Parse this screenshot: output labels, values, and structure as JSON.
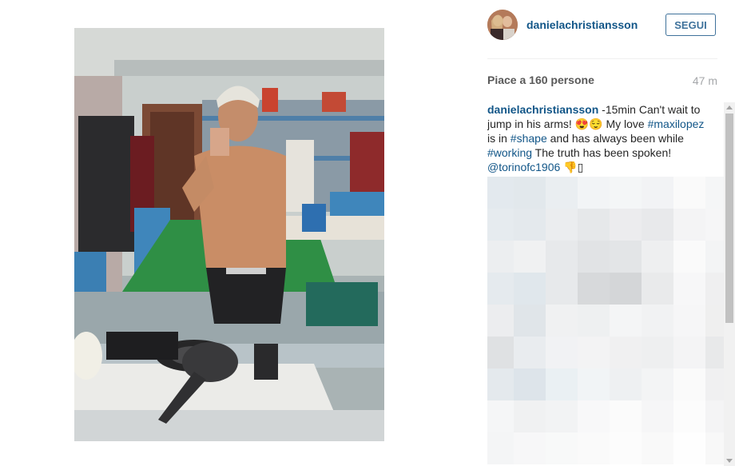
{
  "post": {
    "photo_alt": "Mirror selfie in a locker room"
  },
  "header": {
    "username": "danielachristiansson",
    "follow_label": "SEGUI"
  },
  "stats": {
    "likes": "Piace a 160 persone",
    "time_ago": "47 m"
  },
  "caption": {
    "author": "danielachristiansson",
    "text_1": " -15min Can't wait to jump in his arms! 😍😌 My love ",
    "mention_1": "#maxilopez",
    "text_2": " is in ",
    "hashtag_1": "#shape",
    "text_3": " and has always been while ",
    "hashtag_2": "#working",
    "text_4": " The truth has been spoken! ",
    "mention_2": "@torinofc1906",
    "text_5": " 👎▯"
  },
  "blurred_comments": {
    "colors": [
      "#e3e9ee",
      "#e2e8ec",
      "#eaeef1",
      "#f2f4f6",
      "#f4f6f7",
      "#f2f3f5",
      "#fafafa",
      "#f5f6f7",
      "#e6ebef",
      "#e4e9ed",
      "#ebedef",
      "#e6e8ea",
      "#ececee",
      "#e8e9eb",
      "#f4f4f5",
      "#f6f6f7",
      "#eceef0",
      "#f0f1f2",
      "#e7e9eb",
      "#e1e3e5",
      "#e3e5e7",
      "#eeeff0",
      "#fafafa",
      "#f3f4f5",
      "#e5eaee",
      "#e0e7ec",
      "#e7e9eb",
      "#d7d9db",
      "#d4d6d8",
      "#e9eaeb",
      "#f7f7f8",
      "#efeff0",
      "#ecedef",
      "#e0e5e9",
      "#f0f1f2",
      "#eef0f1",
      "#f4f5f6",
      "#f1f2f3",
      "#f6f6f7",
      "#efefef",
      "#dfe1e3",
      "#e9ecef",
      "#f1f2f4",
      "#f3f3f4",
      "#f0f0f1",
      "#eeeff0",
      "#f4f4f5",
      "#e8e9ea",
      "#e4e9ed",
      "#dde4ea",
      "#eaf0f3",
      "#f1f4f6",
      "#eef0f2",
      "#f3f4f5",
      "#fafafa",
      "#f0f0f1",
      "#f5f6f7",
      "#f0f1f2",
      "#f2f3f4",
      "#f8f8f9",
      "#fbfbfb",
      "#f6f6f7",
      "#fcfcfc",
      "#f4f4f5",
      "#f4f5f6",
      "#f7f7f8",
      "#f8f9f9",
      "#fafafa",
      "#fcfcfc",
      "#f9f9f9",
      "#fefefe",
      "#f8f8f8"
    ]
  },
  "colors": {
    "link_blue": "#125688",
    "follow_blue": "#3f729b",
    "muted_gray": "#a5a7aa"
  }
}
